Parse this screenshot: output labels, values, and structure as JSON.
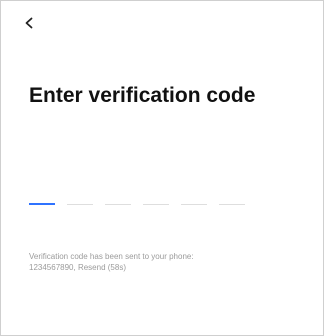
{
  "header": {
    "back_icon": "chevron-left-icon"
  },
  "main": {
    "title": "Enter verification code",
    "code_slots": [
      "",
      "",
      "",
      "",
      "",
      ""
    ],
    "active_slot": 1,
    "notice_line_1": "Verification code has been sent to your phone:",
    "notice_line_2_number": "1234567890",
    "notice_line_2_separator": ", ",
    "notice_line_2_resend": "Resend (58s)"
  },
  "colors": {
    "active_underline": "#2f73ff",
    "inactive_underline": "#dedede",
    "helper_text": "#9b9b9b",
    "title_text": "#111111"
  }
}
